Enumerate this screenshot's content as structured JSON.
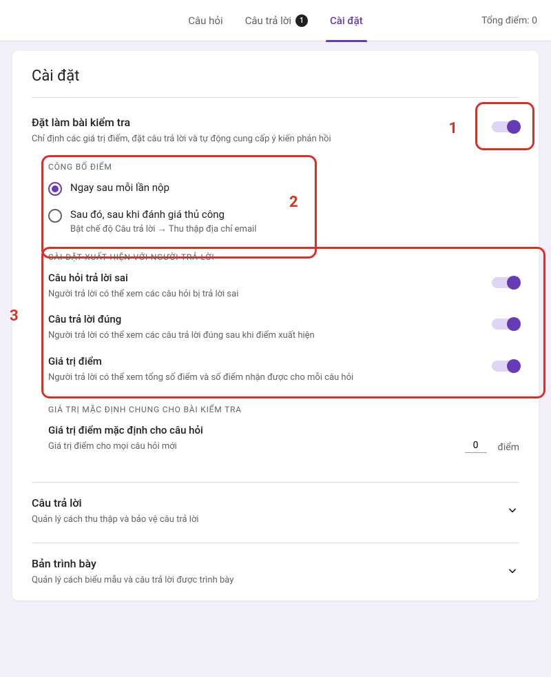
{
  "topbar": {
    "tab_questions": "Câu hỏi",
    "tab_responses": "Câu trả lời",
    "responses_count": "1",
    "tab_settings": "Cài đặt",
    "total_score": "Tổng điểm: 0"
  },
  "page_title": "Cài đặt",
  "quiz": {
    "title": "Đặt làm bài kiểm tra",
    "desc": "Chỉ định các giá trị điểm, đặt câu trả lời và tự động cung cấp ý kiến phản hồi"
  },
  "release": {
    "label": "CÔNG BỐ ĐIỂM",
    "opt1": "Ngay sau mỗi lần nộp",
    "opt2": "Sau đó, sau khi đánh giá thủ công",
    "opt2_sub": "Bật chế độ Câu trả lời → Thu thập địa chỉ email"
  },
  "responder": {
    "label": "CÀI ĐẶT XUẤT HIỆN VỚI NGƯỜI TRẢ LỜI",
    "missed_title": "Câu hỏi trả lời sai",
    "missed_desc": "Người trả lời có thể xem các câu hỏi bị trả lời sai",
    "correct_title": "Câu trả lời đúng",
    "correct_desc": "Người trả lời có thể xem các câu trả lời đúng sau khi điểm xuất hiện",
    "points_title": "Giá trị điểm",
    "points_desc": "Người trả lời có thể xem tổng số điểm và số điểm nhận được cho mỗi câu hỏi"
  },
  "defaults": {
    "label": "GIÁ TRỊ MẶC ĐỊNH CHUNG CHO BÀI KIỂM TRA",
    "title": "Giá trị điểm mặc định cho câu hỏi",
    "desc": "Giá trị điểm cho mọi câu hỏi mới",
    "value": "0",
    "unit": "điểm"
  },
  "responses_section": {
    "title": "Câu trả lời",
    "desc": "Quản lý cách thu thập và bảo vệ câu trả lời"
  },
  "presentation_section": {
    "title": "Bản trình bày",
    "desc": "Quản lý cách biểu mẫu và câu trả lời được trình bày"
  },
  "annotations": {
    "n1": "1",
    "n2": "2",
    "n3": "3"
  }
}
